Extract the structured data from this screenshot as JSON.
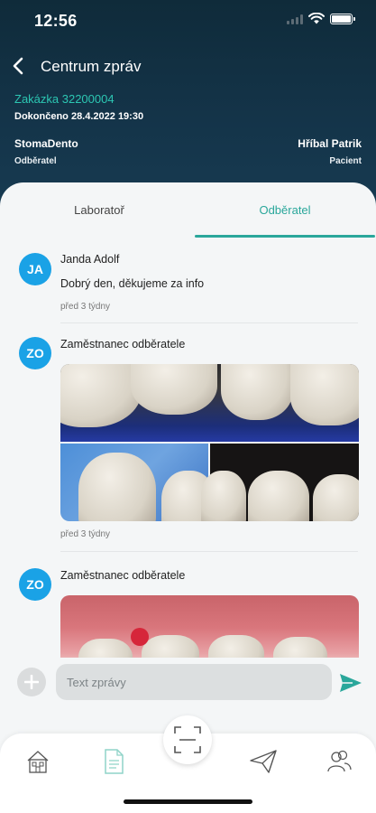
{
  "status_bar": {
    "time": "12:56"
  },
  "header": {
    "title": "Centrum zpráv",
    "order_link": "Zakázka 32200004",
    "completed": "Dokončeno 28.4.2022 19:30",
    "lab_name": "StomaDento",
    "lab_role": "Odběratel",
    "patient_name": "Hříbal Patrik",
    "patient_role": "Pacient"
  },
  "tabs": [
    {
      "label": "Laboratoř",
      "active": false
    },
    {
      "label": "Odběratel",
      "active": true
    }
  ],
  "messages": [
    {
      "initials": "JA",
      "author": "Janda Adolf",
      "text": "Dobrý den, děkujeme za info",
      "time": "před 3 týdny"
    },
    {
      "initials": "ZO",
      "author": "Zaměstnanec odběratele",
      "attachment": "photo-collage",
      "time": "před 3 týdny"
    },
    {
      "initials": "ZO",
      "author": "Zaměstnanec odběratele",
      "attachment": "photo"
    }
  ],
  "composer": {
    "placeholder": "Text zprávy"
  },
  "bottom_nav": {
    "items": [
      {
        "icon": "building-icon"
      },
      {
        "icon": "document-icon",
        "active": true
      },
      {
        "icon": "paper-plane-icon"
      },
      {
        "icon": "users-icon"
      }
    ],
    "center_button_icon": "qr-scan-icon"
  },
  "colors": {
    "header_bg": "#143449",
    "accent_teal": "#2aa79b",
    "order_link": "#2cc7b3",
    "avatar": "#1aa2e6"
  }
}
